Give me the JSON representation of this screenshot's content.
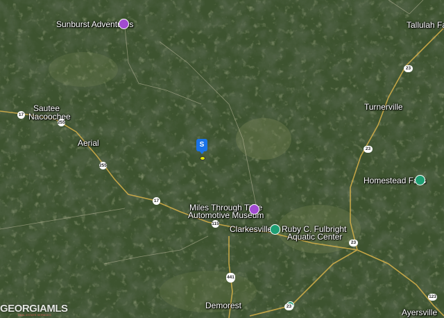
{
  "map": {
    "type": "satellite",
    "places": {
      "sunburst": "Sunburst Adventures",
      "tallulah": "Tallulah Falls",
      "sautee_1": "Sautee",
      "sautee_2": "Nacoochee",
      "turnerville": "Turnerville",
      "aerial": "Aerial",
      "homestead": "Homestead Falls",
      "miles_1": "Miles Through Time",
      "miles_2": "Automotive Museum",
      "clarkesville": "Clarkesville",
      "ruby_1": "Ruby C. Fulbright",
      "ruby_2": "Aquatic Center",
      "demorest": "Demorest",
      "ayersville": "Ayersville"
    },
    "routes": {
      "r17a": "17",
      "r255a": "255",
      "r255b": "255",
      "r17b": "17",
      "r115": "115",
      "r23a": "23",
      "r23b": "23",
      "r23c": "23",
      "r23d": "23",
      "r441": "441",
      "r123": "123"
    },
    "marker_label": "S",
    "watermark": "GEORGIAMLS",
    "watermark_sub": "REAL ESTATE SERVICES"
  },
  "colors": {
    "forest_dark": "#2a3b22",
    "forest": "#3a5130",
    "field": "#6b7a4e",
    "road": "#d9b24a",
    "poi_purple": "#a14bd1",
    "poi_green": "#1e9e73",
    "marker_blue": "#1a73e8"
  }
}
